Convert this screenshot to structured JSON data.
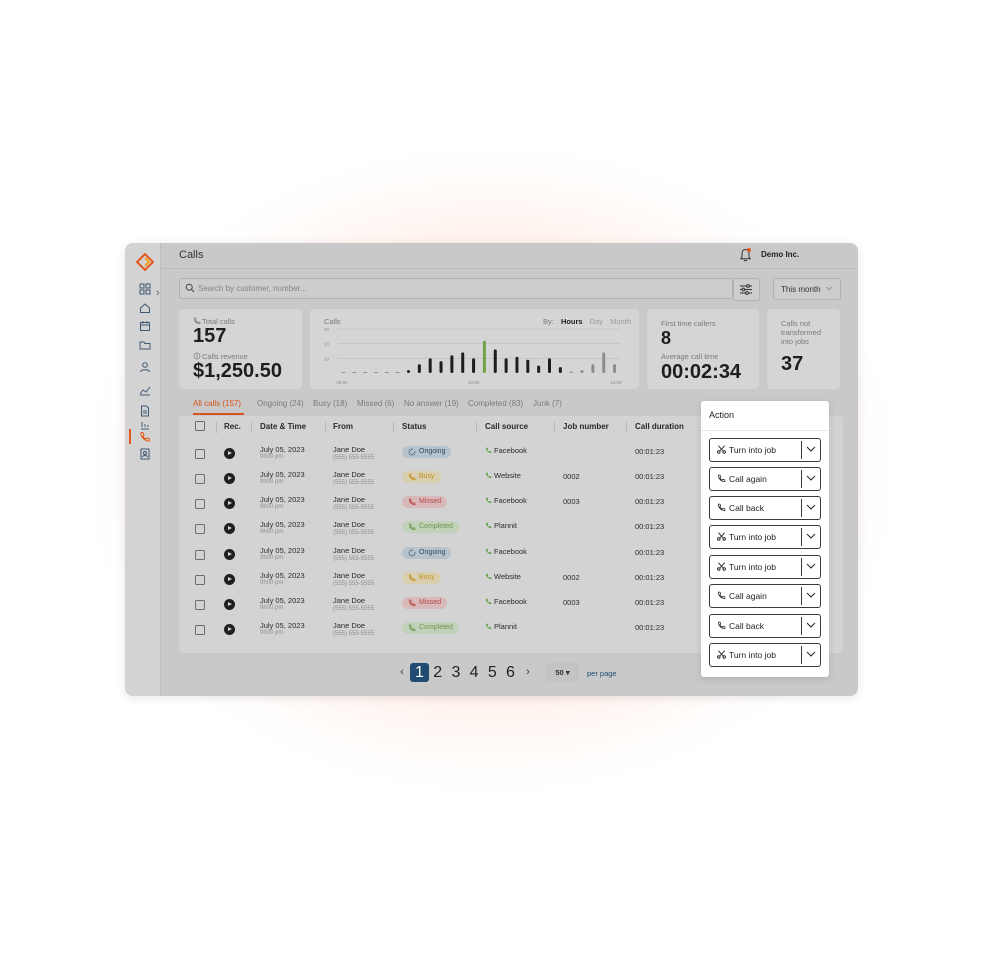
{
  "header": {
    "page_title": "Calls",
    "company": "Demo Inc."
  },
  "search": {
    "placeholder": "Search by customer, number..."
  },
  "period_select": {
    "value": "This month"
  },
  "cards": {
    "total_calls": {
      "label": "Total calls",
      "value": "157"
    },
    "calls_revenue": {
      "label": "Calls revenue",
      "value": "$1,250.50"
    },
    "first_time_callers": {
      "label": "First time callers",
      "value": "8"
    },
    "average_call_time": {
      "label": "Average call time",
      "value": "00:02:34"
    },
    "not_transformed": {
      "label": "Calls not transformed into jobs",
      "value": "37"
    }
  },
  "chart_data": {
    "type": "bar",
    "title": "Calls",
    "by_label": "By:",
    "by_options": [
      "Hours",
      "Day",
      "Month"
    ],
    "selected_option": "Hours",
    "x_tick_labels": [
      "00:00",
      "12:00",
      "23:00"
    ],
    "y_tick_labels": [
      "30",
      "20",
      "10"
    ],
    "ylim": [
      0,
      30
    ],
    "values": [
      0,
      0,
      0,
      0,
      0,
      0,
      2,
      6,
      10,
      8,
      12,
      14,
      10,
      22,
      16,
      10,
      11,
      9,
      5,
      10,
      4,
      1,
      2,
      6,
      14,
      6
    ],
    "highlight_index": 13,
    "highlight_color": "#6ea447",
    "bar_color": "#1d1d1d",
    "muted_indices": [
      0,
      1,
      2,
      3,
      4,
      5,
      21,
      22,
      23,
      24,
      25
    ],
    "muted_color": "#8d8d8d"
  },
  "tabs": [
    {
      "label": "All calls (157)",
      "active": true
    },
    {
      "label": "Ongoing (24)",
      "active": false
    },
    {
      "label": "Busy (18)",
      "active": false
    },
    {
      "label": "Missed (6)",
      "active": false
    },
    {
      "label": "No answer (19)",
      "active": false
    },
    {
      "label": "Completed (83)",
      "active": false
    },
    {
      "label": "Junk (7)",
      "active": false
    }
  ],
  "table": {
    "columns": [
      "Rec.",
      "Date & Time",
      "From",
      "Status",
      "Call source",
      "Job number",
      "Call duration"
    ],
    "rows": [
      {
        "date": "July 05, 2023",
        "time": "9h00 pm",
        "from": "Jane Doe",
        "phone": "(555) 555-5555",
        "status": "Ongoing",
        "source": "Facebook",
        "job": "",
        "duration": "00:01:23"
      },
      {
        "date": "July 05, 2023",
        "time": "9h00 pm",
        "from": "Jane Doe",
        "phone": "(555) 555-5555",
        "status": "Busy",
        "source": "Website",
        "job": "0002",
        "duration": "00:01:23"
      },
      {
        "date": "July 05, 2023",
        "time": "9h00 pm",
        "from": "Jane Doe",
        "phone": "(555) 555-5555",
        "status": "Missed",
        "source": "Facebook",
        "job": "0003",
        "duration": "00:01:23"
      },
      {
        "date": "July 05, 2023",
        "time": "9h00 pm",
        "from": "Jane Doe",
        "phone": "(555) 555-5555",
        "status": "Completed",
        "source": "Plannit",
        "job": "",
        "duration": "00:01:23"
      },
      {
        "date": "July 05, 2023",
        "time": "9h00 pm",
        "from": "Jane Doe",
        "phone": "(555) 555-5555",
        "status": "Ongoing",
        "source": "Facebook",
        "job": "",
        "duration": "00:01:23"
      },
      {
        "date": "July 05, 2023",
        "time": "9h00 pm",
        "from": "Jane Doe",
        "phone": "(555) 555-5555",
        "status": "Busy",
        "source": "Website",
        "job": "0002",
        "duration": "00:01:23"
      },
      {
        "date": "July 05, 2023",
        "time": "9h00 pm",
        "from": "Jane Doe",
        "phone": "(555) 555-5555",
        "status": "Missed",
        "source": "Facebook",
        "job": "0003",
        "duration": "00:01:23"
      },
      {
        "date": "July 05, 2023",
        "time": "9h00 pm",
        "from": "Jane Doe",
        "phone": "(555) 555-5555",
        "status": "Completed",
        "source": "Plannit",
        "job": "",
        "duration": "00:01:23"
      }
    ]
  },
  "pagination": {
    "pages": [
      "1",
      "2",
      "3",
      "4",
      "5",
      "6"
    ],
    "current": "1",
    "per_page_value": "50",
    "per_page_label": "per page"
  },
  "action_panel": {
    "title": "Action",
    "buttons": [
      {
        "label": "Turn into job",
        "icon": "scissors-icon"
      },
      {
        "label": "Call again",
        "icon": "phone-icon"
      },
      {
        "label": "Call back",
        "icon": "phone-icon"
      },
      {
        "label": "Turn into job",
        "icon": "scissors-icon"
      },
      {
        "label": "Turn into job",
        "icon": "scissors-icon"
      },
      {
        "label": "Call again",
        "icon": "phone-icon"
      },
      {
        "label": "Call back",
        "icon": "phone-icon"
      },
      {
        "label": "Turn into job",
        "icon": "scissors-icon"
      }
    ]
  },
  "colors": {
    "accent": "#d8521f",
    "primary": "#1f4c70",
    "green": "#6ea447"
  }
}
